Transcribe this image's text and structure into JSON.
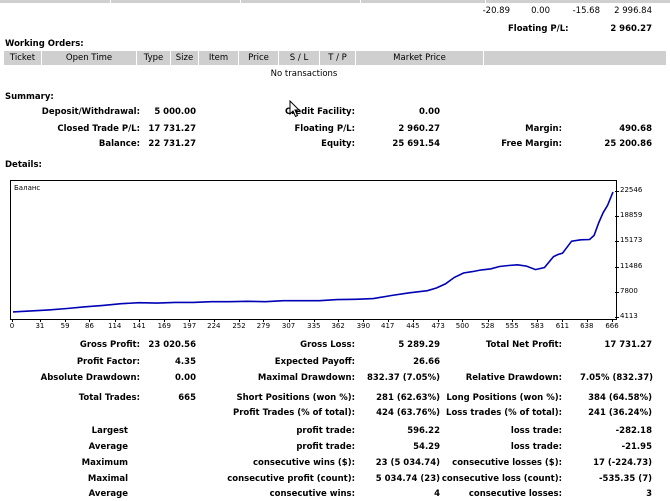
{
  "top_row": {
    "v1": "-20.89",
    "v2": "0.00",
    "v3": "-15.68",
    "v4": "2 996.84"
  },
  "floating_top": {
    "label": "Floating P/L:",
    "value": "2 960.27"
  },
  "working_orders": {
    "title": "Working Orders:",
    "columns": [
      "Ticket",
      "Open Time",
      "Type",
      "Size",
      "Item",
      "Price",
      "S / L",
      "T / P",
      "Market Price"
    ],
    "empty_text": "No transactions"
  },
  "summary": {
    "title": "Summary:",
    "deposit_label": "Deposit/Withdrawal:",
    "deposit_value": "5 000.00",
    "credit_label": "Credit Facility:",
    "credit_value": "0.00",
    "closed_label": "Closed Trade P/L:",
    "closed_value": "17 731.27",
    "floating_label": "Floating P/L:",
    "floating_value": "2 960.27",
    "margin_label": "Margin:",
    "margin_value": "490.68",
    "balance_label": "Balance:",
    "balance_value": "22 731.27",
    "equity_label": "Equity:",
    "equity_value": "25 691.54",
    "free_margin_label": "Free Margin:",
    "free_margin_value": "25 200.86"
  },
  "details": {
    "title": "Details:"
  },
  "chart_data": {
    "type": "line",
    "title": "Баланс",
    "x_ticks": [
      "0",
      "31",
      "59",
      "86",
      "114",
      "141",
      "169",
      "197",
      "224",
      "252",
      "279",
      "307",
      "335",
      "362",
      "390",
      "417",
      "445",
      "473",
      "500",
      "528",
      "555",
      "583",
      "611",
      "638",
      "666"
    ],
    "y_ticks": [
      "22546",
      "18859",
      "15173",
      "11486",
      "7800",
      "4113"
    ],
    "ylim": [
      4113,
      22546
    ],
    "xlim": [
      0,
      666
    ],
    "line_color": "#0000b4",
    "series": [
      {
        "x": [
          0,
          20,
          40,
          60,
          80,
          100,
          120,
          140,
          160,
          180,
          200,
          220,
          240,
          260,
          280,
          300,
          320,
          340,
          360,
          380,
          400,
          420,
          440,
          460,
          470,
          480,
          490,
          500,
          510,
          520,
          530,
          540,
          550,
          560,
          570,
          580,
          590,
          600,
          605,
          610,
          620,
          630,
          640,
          645,
          650,
          655,
          660,
          666
        ],
        "values": [
          5000,
          5150,
          5300,
          5500,
          5750,
          5950,
          6200,
          6350,
          6300,
          6400,
          6400,
          6500,
          6500,
          6550,
          6500,
          6650,
          6650,
          6650,
          6800,
          6850,
          6950,
          7400,
          7800,
          8100,
          8500,
          9100,
          10050,
          10700,
          10900,
          11150,
          11300,
          11650,
          11800,
          11900,
          11700,
          11200,
          11500,
          13100,
          13400,
          13600,
          15350,
          15550,
          15600,
          16200,
          18000,
          19500,
          20600,
          22546
        ]
      }
    ]
  },
  "stats": {
    "gross_profit_label": "Gross Profit:",
    "gross_profit": "23 020.56",
    "gross_loss_label": "Gross Loss:",
    "gross_loss": "5 289.29",
    "total_net_label": "Total Net Profit:",
    "total_net": "17 731.27",
    "profit_factor_label": "Profit Factor:",
    "profit_factor": "4.35",
    "expected_payoff_label": "Expected Payoff:",
    "expected_payoff": "26.66",
    "abs_dd_label": "Absolute Drawdown:",
    "abs_dd": "0.00",
    "max_dd_label": "Maximal Drawdown:",
    "max_dd": "832.37 (7.05%)",
    "rel_dd_label": "Relative Drawdown:",
    "rel_dd": "7.05% (832.37)",
    "total_trades_label": "Total Trades:",
    "total_trades": "665",
    "short_label": "Short Positions (won %):",
    "short_value": "281 (62.63%)",
    "long_label": "Long Positions (won %):",
    "long_value": "384 (64.58%)",
    "profit_trades_label": "Profit Trades (% of total):",
    "profit_trades": "424 (63.76%)",
    "loss_trades_label": "Loss trades (% of total):",
    "loss_trades": "241 (36.24%)",
    "largest_label": "Largest",
    "lg_profit_label": "profit trade:",
    "lg_profit": "596.22",
    "lg_loss_label": "loss trade:",
    "lg_loss": "-282.18",
    "average_label": "Average",
    "av_profit_label": "profit trade:",
    "av_profit": "54.29",
    "av_loss_label": "loss trade:",
    "av_loss": "-21.95",
    "maximum_label": "Maximum",
    "mx_wins_label": "consecutive wins ($):",
    "mx_wins": "23 (5 034.74)",
    "mx_losses_label": "consecutive losses ($):",
    "mx_losses": "17 (-224.73)",
    "maximal_label": "Maximal",
    "ml_profit_label": "consecutive profit (count):",
    "ml_profit": "5 034.74 (23)",
    "ml_loss_label": "consecutive loss (count):",
    "ml_loss": "-535.35 (7)",
    "average2_label": "Average",
    "ac_wins_label": "consecutive wins:",
    "ac_wins": "4",
    "ac_losses_label": "consecutive losses:",
    "ac_losses": "3"
  }
}
